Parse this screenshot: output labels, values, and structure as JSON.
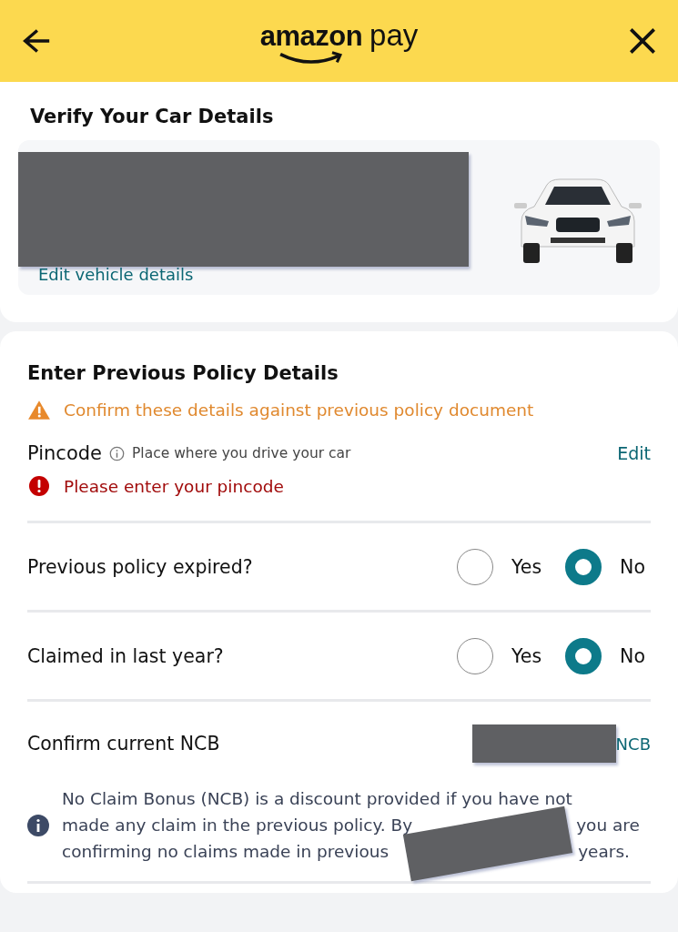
{
  "header": {
    "logo": {
      "brand": "amazon",
      "product": "pay"
    }
  },
  "vehicle": {
    "title": "Verify Your Car Details",
    "edit_link": "Edit vehicle details"
  },
  "policy": {
    "title": "Enter Previous Policy Details",
    "warning": "Confirm these details against previous policy document",
    "pincode": {
      "label": "Pincode",
      "hint": "Place where you drive your car",
      "edit": "Edit",
      "error": "Please enter your pincode"
    },
    "questions": [
      {
        "label": "Previous policy expired?",
        "options": [
          {
            "label": "Yes",
            "selected": false
          },
          {
            "label": "No",
            "selected": true
          }
        ]
      },
      {
        "label": "Claimed in last year?",
        "options": [
          {
            "label": "Yes",
            "selected": false
          },
          {
            "label": "No",
            "selected": true
          }
        ]
      }
    ],
    "ncb": {
      "label": "Confirm current NCB",
      "value": "NCB",
      "info_lines": [
        [
          "No Claim Bonus (NCB) is a discount provided if you have not"
        ],
        [
          "made any claim in the previous policy. By",
          "you are"
        ],
        [
          "confirming no claims made in previous",
          "years."
        ]
      ]
    }
  }
}
